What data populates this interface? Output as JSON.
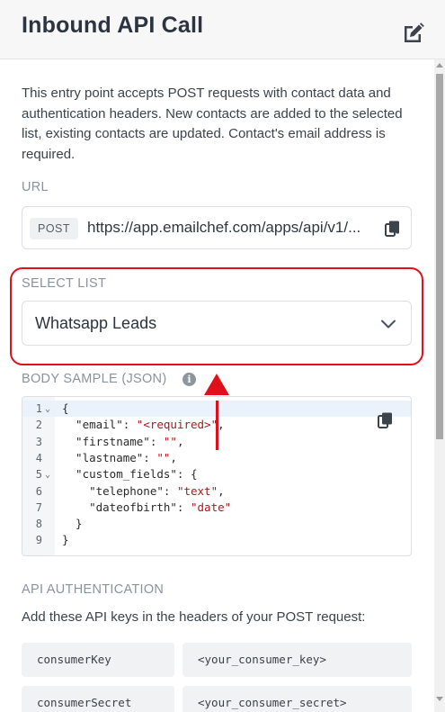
{
  "header": {
    "title": "Inbound API Call",
    "edit_icon": "edit-icon"
  },
  "description": "This entry point accepts POST requests with contact data and authentication headers. New contacts are added to the selected list, existing contacts are updated. Contact's email address is required.",
  "url_section": {
    "label": "URL",
    "method": "POST",
    "url": "https://app.emailchef.com/apps/api/v1/...",
    "copy_icon": "copy-icon"
  },
  "select_list": {
    "label": "SELECT LIST",
    "value": "Whatsapp Leads"
  },
  "body_sample": {
    "label": "BODY SAMPLE (JSON)",
    "info_glyph": "i",
    "line_numbers": [
      "1",
      "2",
      "3",
      "4",
      "5",
      "6",
      "7",
      "8",
      "9"
    ]
  },
  "api_auth": {
    "label": "API AUTHENTICATION",
    "description": "Add these API keys in the headers of your POST request:",
    "rows": [
      {
        "key": "consumerKey",
        "value": "<your_consumer_key>"
      },
      {
        "key": "consumerSecret",
        "value": "<your_consumer_secret>"
      }
    ]
  },
  "annotation": {
    "highlight_color": "#e0101a"
  },
  "colors": {
    "accent_red": "#e0101a",
    "string_red": "#b1161c",
    "muted_label": "#8a939d"
  }
}
